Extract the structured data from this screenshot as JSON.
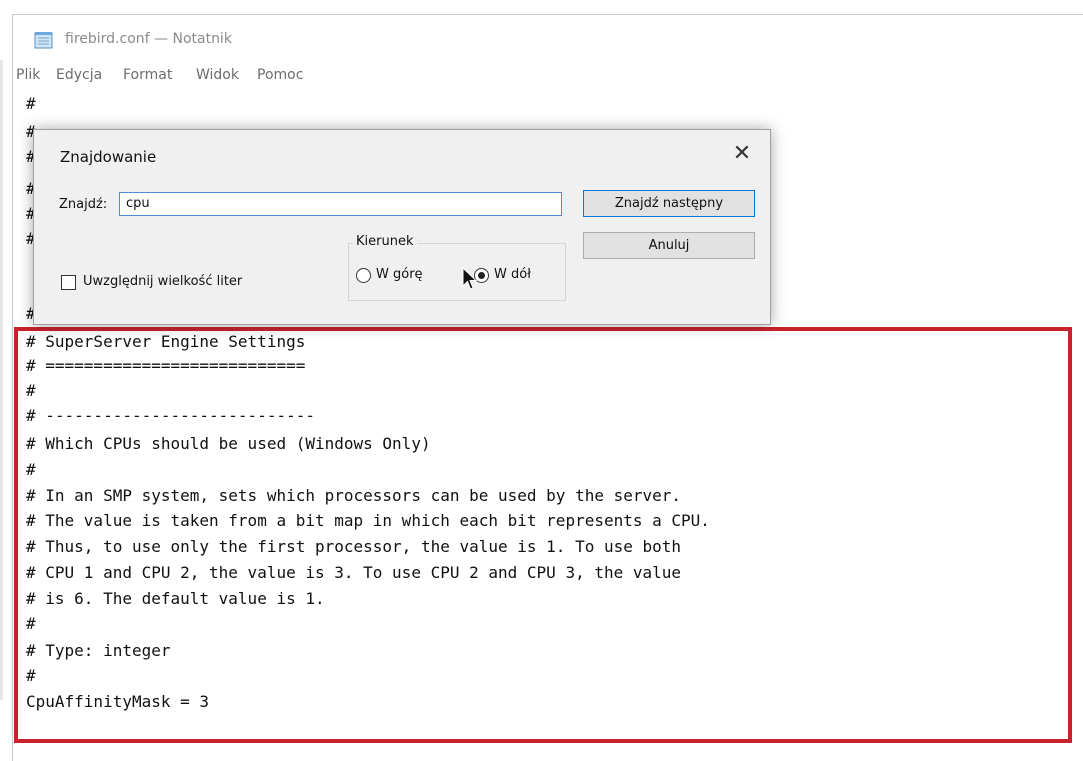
{
  "window": {
    "title": "firebird.conf — Notatnik",
    "menu": [
      "Plik",
      "Edycja",
      "Format",
      "Widok",
      "Pomoc"
    ]
  },
  "editor": {
    "top_lines": [
      "#",
      "#",
      "#",
      "#",
      "#",
      "#!",
      "#"
    ],
    "highlighted_lines": [
      "# SuperServer Engine Settings",
      "# ===========================",
      "#",
      "# ----------------------------",
      "# Which CPUs should be used (Windows Only)",
      "#",
      "# In an SMP system, sets which processors can be used by the server.",
      "# The value is taken from a bit map in which each bit represents a CPU.",
      "# Thus, to use only the first processor, the value is 1. To use both",
      "# CPU 1 and CPU 2, the value is 3. To use CPU 2 and CPU 3, the value",
      "# is 6. The default value is 1.",
      "#",
      "# Type: integer",
      "#",
      "CpuAffinityMask = 3"
    ],
    "highlight_color": "#c8232c"
  },
  "find_dialog": {
    "title": "Znajdowanie",
    "close_label": "✕",
    "find_label": "Znajdź:",
    "find_value": "cpu",
    "find_next_label": "Znajdź następny",
    "cancel_label": "Anuluj",
    "direction_label": "Kierunek",
    "direction_up_label": "W górę",
    "direction_down_label": "W dół",
    "direction_selected": "down",
    "match_case_label": "Uwzględnij wielkość liter",
    "match_case_checked": false
  },
  "icons": [
    "notepad-icon",
    "close-icon",
    "mouse-cursor-icon"
  ]
}
